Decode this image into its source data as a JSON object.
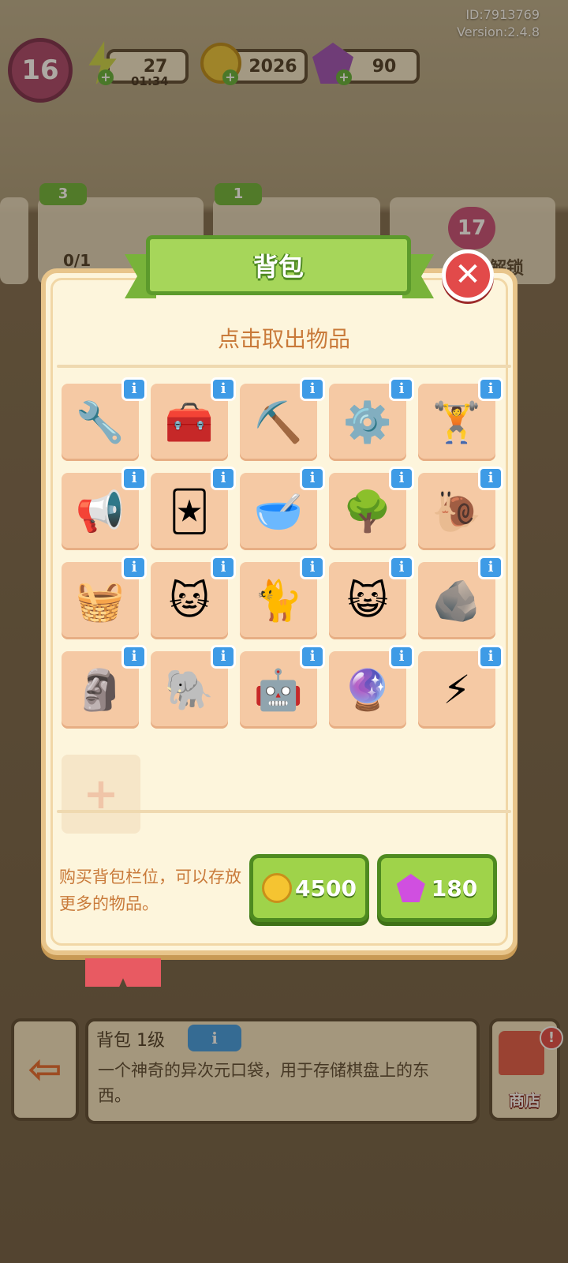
{
  "header": {
    "id_text": "ID:7913769",
    "version_text": "Version:2.4.8",
    "level": "16",
    "energy": "27",
    "energy_timer": "01:34",
    "coins": "2026",
    "gems": "90"
  },
  "background": {
    "order1_badge": "3",
    "order1_progress": "0/1",
    "order2_badge": "1",
    "heart_level": "17",
    "unlock_text": "解锁"
  },
  "dialog": {
    "title": "背包",
    "hint": "点击取出物品",
    "items": [
      {
        "icon": "drill-icon",
        "glyph": "🔧"
      },
      {
        "icon": "toolbox-icon",
        "glyph": "🧰"
      },
      {
        "icon": "pickaxe-icon",
        "glyph": "⛏️"
      },
      {
        "icon": "ab-wheel-icon",
        "glyph": "⚙️"
      },
      {
        "icon": "exercise-bench-icon",
        "glyph": "🏋️"
      },
      {
        "icon": "megaphone-icon",
        "glyph": "📢"
      },
      {
        "icon": "cat-card-icon",
        "glyph": "🃏"
      },
      {
        "icon": "mortar-icon",
        "glyph": "🥣"
      },
      {
        "icon": "potted-tree-icon",
        "glyph": "🌳"
      },
      {
        "icon": "snail-helmet-icon",
        "glyph": "🐌"
      },
      {
        "icon": "basket-icon",
        "glyph": "🧺"
      },
      {
        "icon": "cat-bed-icon",
        "glyph": "🐱"
      },
      {
        "icon": "kitten-icon",
        "glyph": "🐈"
      },
      {
        "icon": "sleeping-cat-icon",
        "glyph": "😺"
      },
      {
        "icon": "mossy-stone-icon",
        "glyph": "🪨"
      },
      {
        "icon": "statue-bust-icon",
        "glyph": "🗿"
      },
      {
        "icon": "animal-statue-icon",
        "glyph": "🐘"
      },
      {
        "icon": "robot-vacuum-icon",
        "glyph": "🤖"
      },
      {
        "icon": "plasma-ball-icon",
        "glyph": "🔮"
      },
      {
        "icon": "energy-orb-icon",
        "glyph": "⚡"
      }
    ],
    "info_label": "i",
    "empty_slot_label": "+",
    "buy_description": "购买背包栏位，可以存放更多的物品。",
    "buy_coin_price": "4500",
    "buy_gem_price": "180",
    "close_label": "✕"
  },
  "footer": {
    "item_title": "背包 1级",
    "info_label": "i",
    "item_description": "一个神奇的异次元口袋，用于存储棋盘上的东西。",
    "shop_label": "商店",
    "exit_label": "⇦",
    "alert_label": "!"
  }
}
